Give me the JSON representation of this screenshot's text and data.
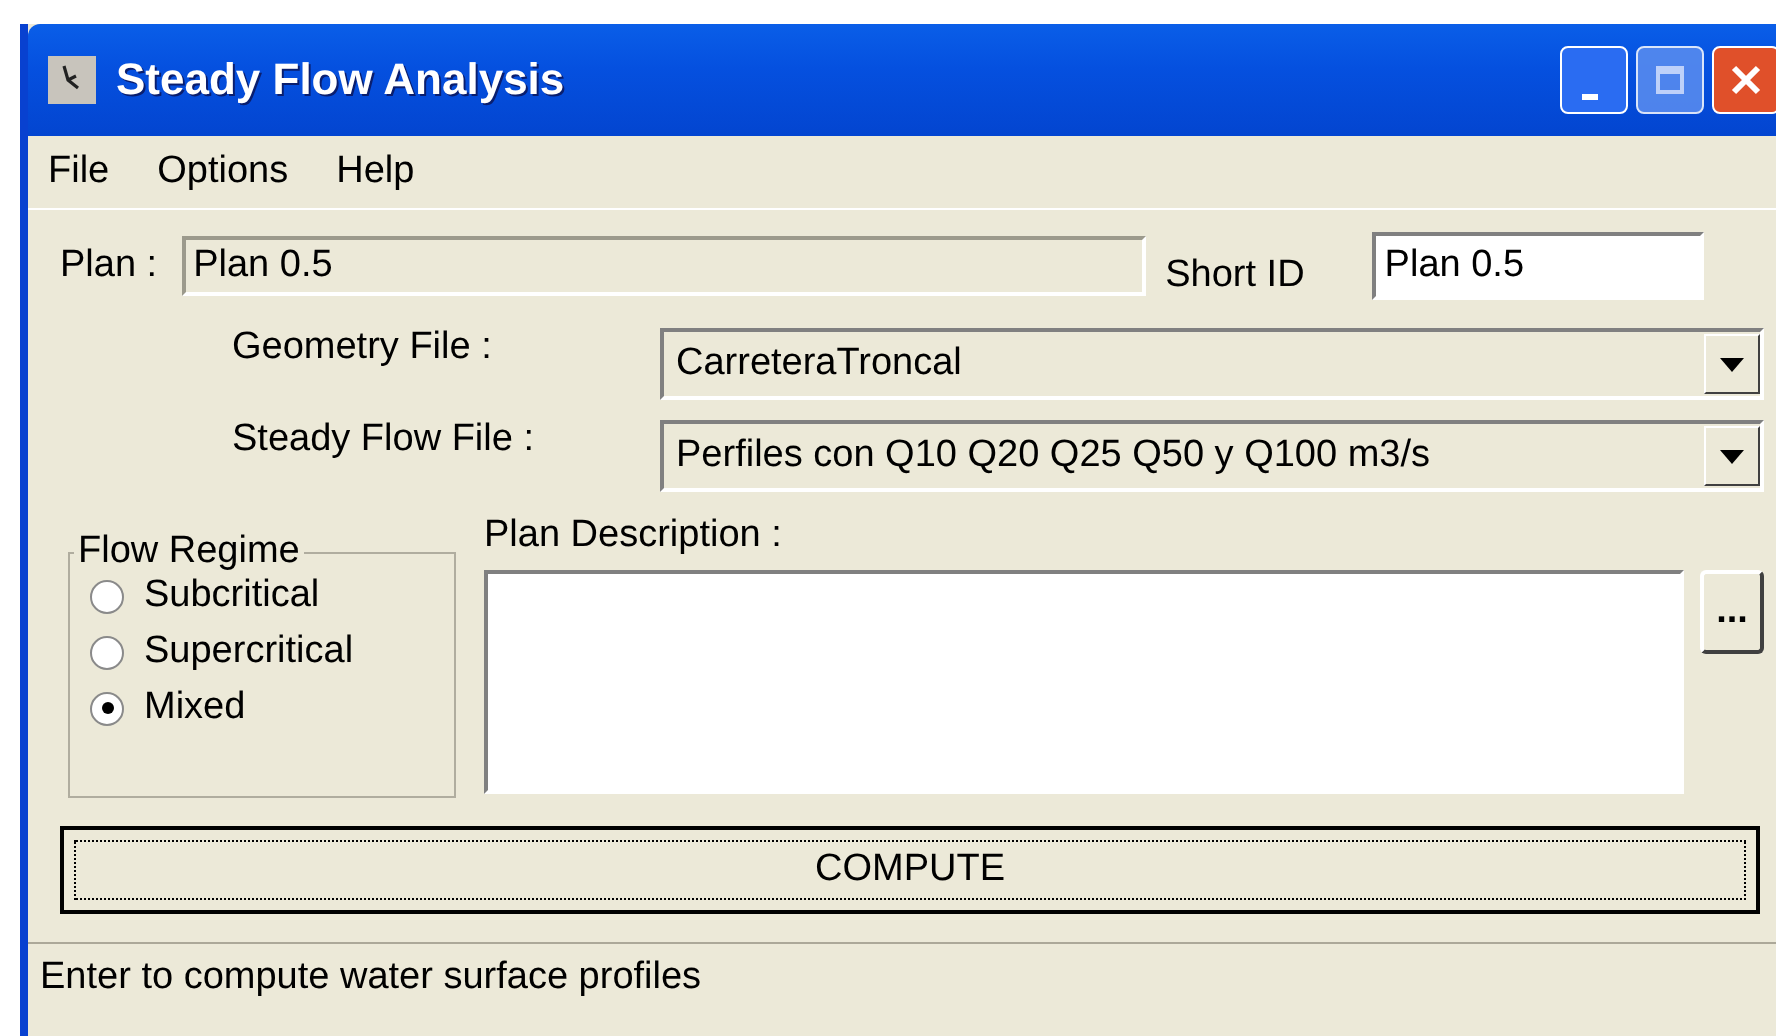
{
  "window": {
    "title": "Steady Flow Analysis"
  },
  "menu": [
    "File",
    "Options",
    "Help"
  ],
  "plan": {
    "label": "Plan :",
    "value": "Plan 0.5"
  },
  "short_id": {
    "label": "Short ID",
    "value": "Plan 0.5"
  },
  "geometry_file": {
    "label": "Geometry File :",
    "value": "CarreteraTroncal"
  },
  "steady_flow_file": {
    "label": "Steady Flow File :",
    "value": "Perfiles con Q10 Q20 Q25 Q50 y Q100 m3/s"
  },
  "flow_regime": {
    "title": "Flow Regime",
    "options": [
      {
        "label": "Subcritical",
        "selected": false
      },
      {
        "label": "Supercritical",
        "selected": false
      },
      {
        "label": "Mixed",
        "selected": true
      }
    ]
  },
  "plan_description": {
    "label": "Plan Description :",
    "browse_button": "..."
  },
  "compute_button": "COMPUTE",
  "status_bar": "Enter to compute water surface profiles"
}
